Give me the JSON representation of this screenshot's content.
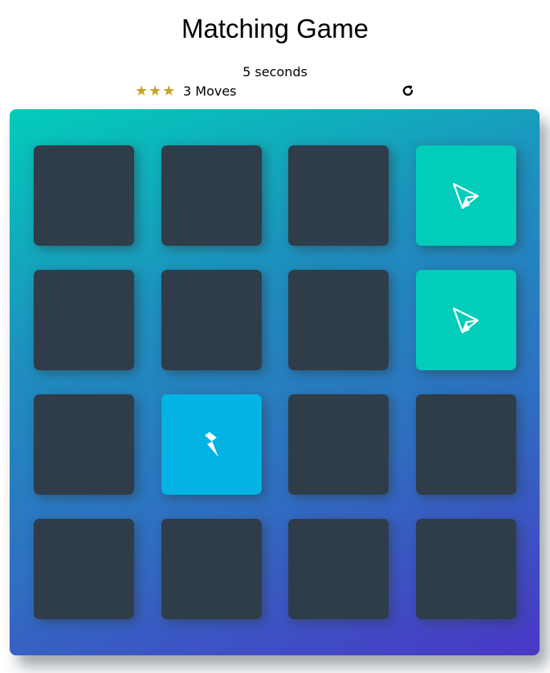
{
  "title": "Matching Game",
  "timer_text": "5 seconds",
  "stars": {
    "filled": 3,
    "total": 3
  },
  "moves_text": "3 Moves",
  "restart_icon": "rotate-right-icon",
  "colors": {
    "card_closed": "#2e3d49",
    "card_match": "#02ccba",
    "card_open": "#02b3e4",
    "star": "#c9a227",
    "deck_gradient_start": "#02ccba",
    "deck_gradient_end": "#4a37c6"
  },
  "cards": [
    {
      "state": "closed",
      "icon": ""
    },
    {
      "state": "closed",
      "icon": ""
    },
    {
      "state": "closed",
      "icon": ""
    },
    {
      "state": "match",
      "icon": "paper-plane-icon"
    },
    {
      "state": "closed",
      "icon": ""
    },
    {
      "state": "closed",
      "icon": ""
    },
    {
      "state": "closed",
      "icon": ""
    },
    {
      "state": "match",
      "icon": "paper-plane-icon"
    },
    {
      "state": "closed",
      "icon": ""
    },
    {
      "state": "open",
      "icon": "bolt-icon"
    },
    {
      "state": "closed",
      "icon": ""
    },
    {
      "state": "closed",
      "icon": ""
    },
    {
      "state": "closed",
      "icon": ""
    },
    {
      "state": "closed",
      "icon": ""
    },
    {
      "state": "closed",
      "icon": ""
    },
    {
      "state": "closed",
      "icon": ""
    }
  ]
}
